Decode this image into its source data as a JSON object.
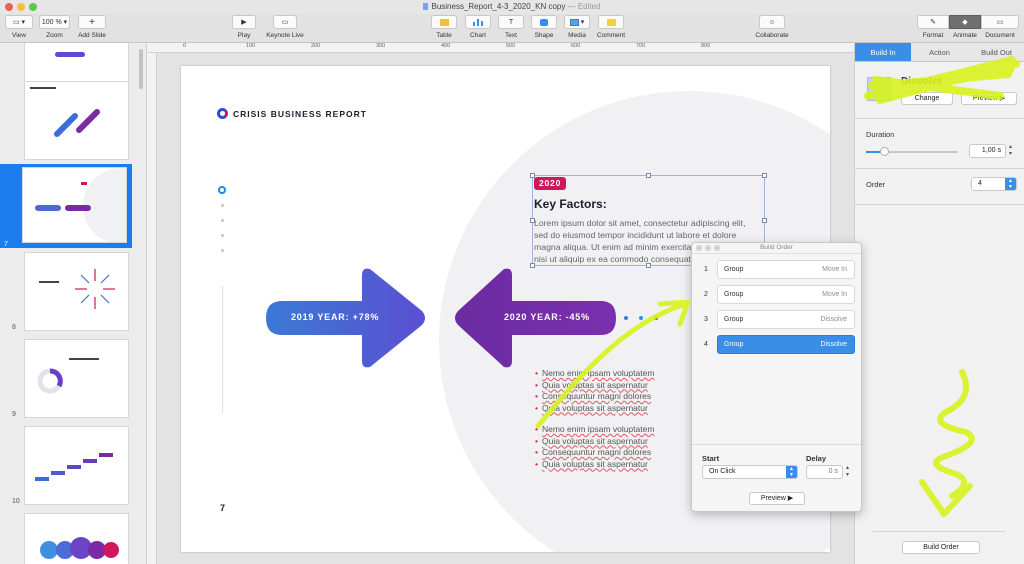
{
  "window": {
    "title": "Business_Report_4-3_2020_KN copy",
    "status": "Edited"
  },
  "toolbar": {
    "view": "View",
    "zoom_value": "100 %",
    "zoom": "Zoom",
    "add_slide": "Add Slide",
    "play": "Play",
    "keynote_live": "Keynote Live",
    "table": "Table",
    "chart": "Chart",
    "text": "Text",
    "shape": "Shape",
    "media": "Media",
    "comment": "Comment",
    "collaborate": "Collaborate",
    "format": "Format",
    "animate": "Animate",
    "document": "Document"
  },
  "ruler": {
    "top": [
      "0",
      "100",
      "200",
      "300",
      "400",
      "500",
      "600",
      "700",
      "800"
    ]
  },
  "navigator": {
    "slide_numbers": [
      "7",
      "8",
      "9",
      "10"
    ],
    "selected": "7"
  },
  "slide": {
    "brand": "CRISIS BUSINESS REPORT",
    "badge": "2020",
    "heading": "Key Factors:",
    "body_lines": [
      "Lorem ipsum dolor sit amet, consectetur adipiscing elit,",
      "sed do eiusmod tempor incididunt ut labore et dolore",
      "magna aliqua. Ut enim ad minim exercitation",
      "nisi ut aliquip ex ea commodo consequat."
    ],
    "arrow_left_label": "2019 YEAR: +78%",
    "arrow_right_label": "2020 YEAR: -45%",
    "bullets_a": [
      "Nemo enim ipsam voluptatem",
      "Quia voluptas sit aspernatur",
      "Consequuntur magni dolores",
      "Quia voluptas sit aspernatur"
    ],
    "bullets_b": [
      "Nemo enim ipsam voluptatem",
      "Quia voluptas sit aspernatur",
      "Consequuntur magni dolores",
      "Quia voluptas sit aspernatur"
    ],
    "page_number": "7"
  },
  "inspector": {
    "tabs": [
      "Build In",
      "Action",
      "Build Out"
    ],
    "active_tab": "Build In",
    "effect": "Dissolve",
    "change": "Change",
    "preview": "Preview",
    "duration_label": "Duration",
    "duration_value": "1,00 s",
    "duration_level": 0.2,
    "order_label": "Order",
    "order_value": "4",
    "build_order_button": "Build Order"
  },
  "build_order": {
    "title": "Build Order",
    "items": [
      {
        "index": "1",
        "name": "Group",
        "effect": "Move In"
      },
      {
        "index": "2",
        "name": "Group",
        "effect": "Move In"
      },
      {
        "index": "3",
        "name": "Group",
        "effect": "Dissolve"
      },
      {
        "index": "4",
        "name": "Group",
        "effect": "Dissolve"
      }
    ],
    "selected_index": "4",
    "start_label": "Start",
    "start_value": "On Click",
    "delay_label": "Delay",
    "delay_value": "0 s",
    "preview": "Preview"
  },
  "colors": {
    "accent": "#3a8ee8",
    "brand": "#d0175b",
    "arrow_blue": "#4a6fd6",
    "arrow_purple": "#7a2ea8",
    "highlighter": "#d7f21e"
  }
}
